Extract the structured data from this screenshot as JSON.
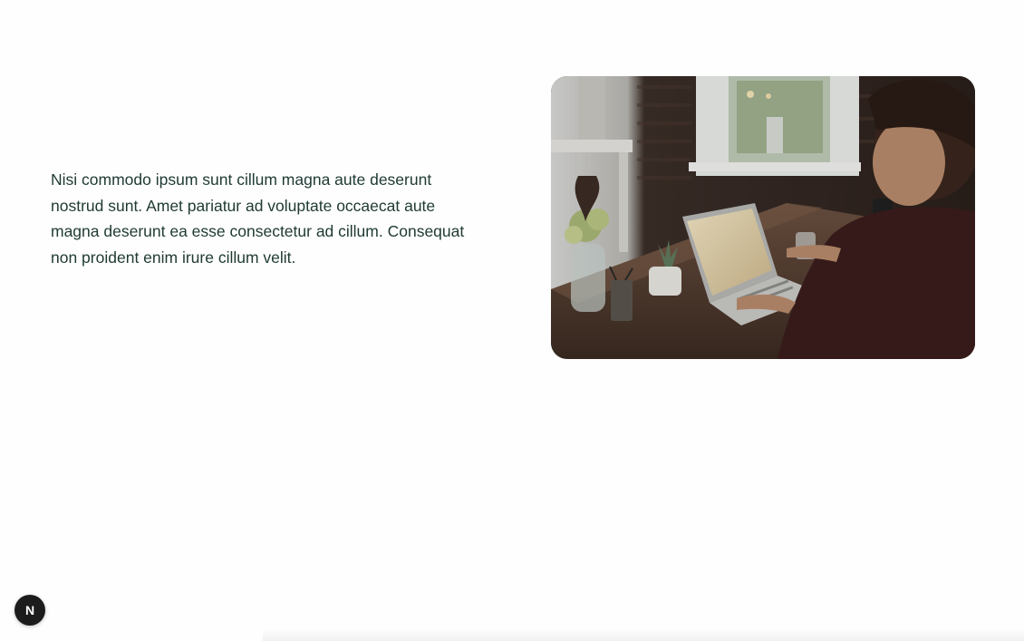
{
  "hero": {
    "text": "Nisi commodo ipsum sunt cillum magna aute deserunt nostrud sunt. Amet pariatur ad voluptate occaecat aute magna deserunt ea esse consectetur ad cillum. Consequat non proident enim irure cillum velit."
  },
  "badge": {
    "letter": "N",
    "icon": "nextjs-logo-icon"
  },
  "colors": {
    "text": "#1f3a33",
    "badge_bg": "#1c1c1c",
    "page_bg": "#fefefe"
  }
}
